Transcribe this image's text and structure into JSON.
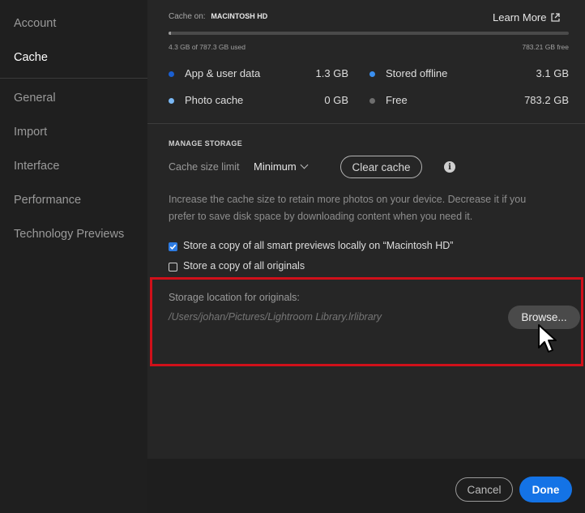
{
  "sidebar": {
    "items": [
      {
        "label": "Account",
        "active": false
      },
      {
        "label": "Cache",
        "active": true
      },
      {
        "label": "General",
        "active": false
      },
      {
        "label": "Import",
        "active": false
      },
      {
        "label": "Interface",
        "active": false
      },
      {
        "label": "Performance",
        "active": false
      },
      {
        "label": "Technology Previews",
        "active": false
      }
    ]
  },
  "cache": {
    "cache_on_label": "Cache on:",
    "drive_name": "MACINTOSH HD",
    "learn_more": "Learn More",
    "used_text": "4.3 GB of 787.3 GB used",
    "free_text": "783.21 GB free",
    "usage_fraction": 0.0055,
    "legend": {
      "app_user_data": {
        "label": "App & user data",
        "value": "1.3 GB",
        "color": "#1a5fd1"
      },
      "stored_offline": {
        "label": "Stored offline",
        "value": "3.1 GB",
        "color": "#3a8ff0"
      },
      "photo_cache": {
        "label": "Photo cache",
        "value": "0 GB",
        "color": "#7ab8f5"
      },
      "free": {
        "label": "Free",
        "value": "783.2 GB",
        "color": "#6e6e6e"
      }
    }
  },
  "manage": {
    "title": "MANAGE STORAGE",
    "size_limit_label": "Cache size limit",
    "size_limit_value": "Minimum",
    "clear_cache": "Clear cache",
    "help_text": "Increase the cache size to retain more photos on your device. Decrease it if you prefer to save disk space by downloading content when you need it.",
    "store_previews": {
      "label": "Store a copy of all smart previews locally on “Macintosh HD”",
      "checked": true
    },
    "store_originals": {
      "label": "Store a copy of all originals",
      "checked": false
    },
    "storage_location_label": "Storage location for originals:",
    "storage_location_path": "/Users/johan/Pictures/Lightroom Library.lrlibrary",
    "browse": "Browse..."
  },
  "footer": {
    "cancel": "Cancel",
    "done": "Done"
  },
  "icons": {
    "external_link": "external-link-icon",
    "info": "info-icon",
    "chevron": "chevron-down-icon",
    "cursor": "mouse-pointer-icon"
  }
}
